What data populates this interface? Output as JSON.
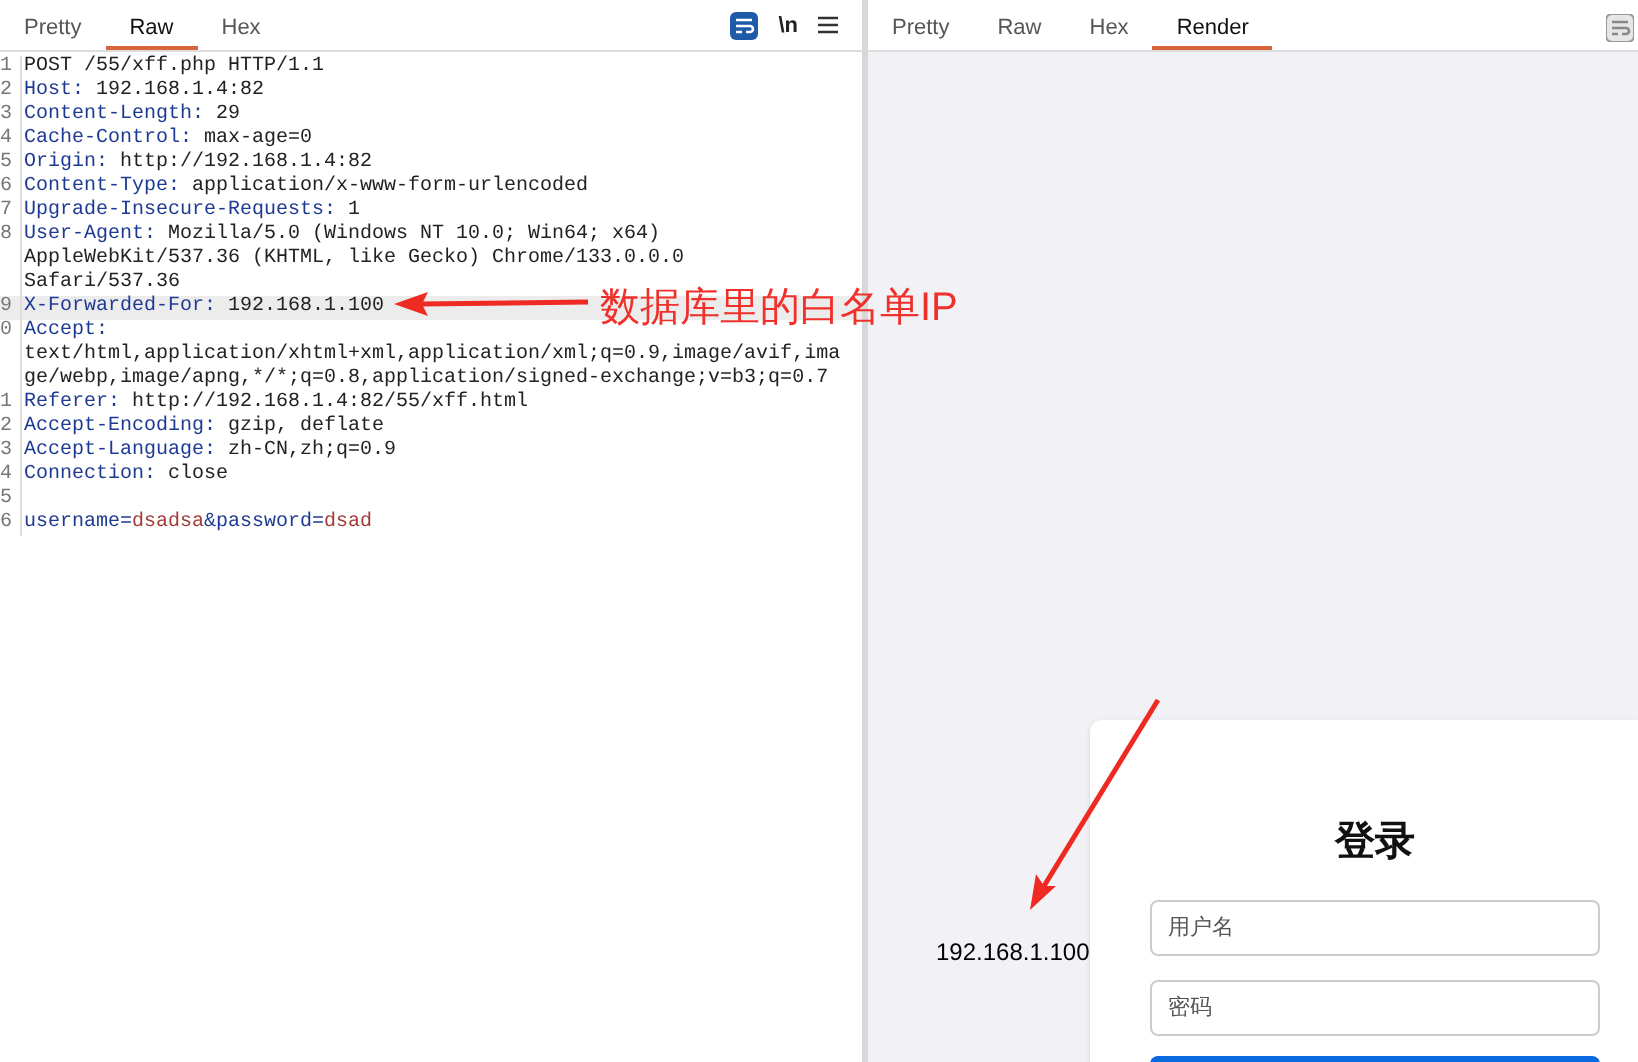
{
  "request_panel": {
    "tabs": [
      {
        "label": "Pretty",
        "selected": false
      },
      {
        "label": "Raw",
        "selected": true
      },
      {
        "label": "Hex",
        "selected": false
      }
    ],
    "newline_toggle": "\\n",
    "lines": [
      {
        "number": "1",
        "highlighted": false,
        "parts": [
          {
            "kind": "plain",
            "text": "POST /55/xff.php HTTP/1.1"
          }
        ]
      },
      {
        "number": "2",
        "highlighted": false,
        "parts": [
          {
            "kind": "name",
            "text": "Host:"
          },
          {
            "kind": "plain",
            "text": " 192.168.1.4:82"
          }
        ]
      },
      {
        "number": "3",
        "highlighted": false,
        "parts": [
          {
            "kind": "name",
            "text": "Content-Length:"
          },
          {
            "kind": "plain",
            "text": " 29"
          }
        ]
      },
      {
        "number": "4",
        "highlighted": false,
        "parts": [
          {
            "kind": "name",
            "text": "Cache-Control:"
          },
          {
            "kind": "plain",
            "text": " max-age=0"
          }
        ]
      },
      {
        "number": "5",
        "highlighted": false,
        "parts": [
          {
            "kind": "name",
            "text": "Origin:"
          },
          {
            "kind": "plain",
            "text": " http://192.168.1.4:82"
          }
        ]
      },
      {
        "number": "6",
        "highlighted": false,
        "parts": [
          {
            "kind": "name",
            "text": "Content-Type:"
          },
          {
            "kind": "plain",
            "text": " application/x-www-form-urlencoded"
          }
        ]
      },
      {
        "number": "7",
        "highlighted": false,
        "parts": [
          {
            "kind": "name",
            "text": "Upgrade-Insecure-Requests:"
          },
          {
            "kind": "plain",
            "text": " 1"
          }
        ]
      },
      {
        "number": "8",
        "highlighted": false,
        "parts": [
          {
            "kind": "name",
            "text": "User-Agent:"
          },
          {
            "kind": "plain",
            "text": " Mozilla/5.0 (Windows NT 10.0; Win64; x64)"
          }
        ]
      },
      {
        "highlighted": false,
        "parts": [
          {
            "kind": "plain",
            "text": "AppleWebKit/537.36 (KHTML, like Gecko) Chrome/133.0.0.0"
          }
        ]
      },
      {
        "highlighted": false,
        "parts": [
          {
            "kind": "plain",
            "text": "Safari/537.36"
          }
        ]
      },
      {
        "number": "9",
        "highlighted": true,
        "parts": [
          {
            "kind": "name",
            "text": "X-Forwarded-For:"
          },
          {
            "kind": "plain",
            "text": " 192.168.1.100"
          }
        ]
      },
      {
        "number": "0",
        "highlighted": false,
        "parts": [
          {
            "kind": "name",
            "text": "Accept:"
          }
        ]
      },
      {
        "highlighted": false,
        "parts": [
          {
            "kind": "plain",
            "text": "text/html,application/xhtml+xml,application/xml;q=0.9,image/avif,ima"
          }
        ]
      },
      {
        "highlighted": false,
        "parts": [
          {
            "kind": "plain",
            "text": "ge/webp,image/apng,*/*;q=0.8,application/signed-exchange;v=b3;q=0.7"
          }
        ]
      },
      {
        "number": "1",
        "highlighted": false,
        "parts": [
          {
            "kind": "name",
            "text": "Referer:"
          },
          {
            "kind": "plain",
            "text": " http://192.168.1.4:82/55/xff.html"
          }
        ]
      },
      {
        "number": "2",
        "highlighted": false,
        "parts": [
          {
            "kind": "name",
            "text": "Accept-Encoding:"
          },
          {
            "kind": "plain",
            "text": " gzip, deflate"
          }
        ]
      },
      {
        "number": "3",
        "highlighted": false,
        "parts": [
          {
            "kind": "name",
            "text": "Accept-Language:"
          },
          {
            "kind": "plain",
            "text": " zh-CN,zh;q=0.9"
          }
        ]
      },
      {
        "number": "4",
        "highlighted": false,
        "parts": [
          {
            "kind": "name",
            "text": "Connection:"
          },
          {
            "kind": "plain",
            "text": " close"
          }
        ]
      },
      {
        "number": "5",
        "highlighted": false
      },
      {
        "number": "6",
        "highlighted": false,
        "parts": [
          {
            "kind": "name",
            "text": "username="
          },
          {
            "kind": "param",
            "text": "dsadsa"
          },
          {
            "kind": "name",
            "text": "&password="
          },
          {
            "kind": "param",
            "text": "dsad"
          }
        ]
      }
    ]
  },
  "annotation": {
    "text": "数据库里的白名单IP"
  },
  "response_panel": {
    "tabs": [
      {
        "label": "Pretty",
        "selected": false
      },
      {
        "label": "Raw",
        "selected": false
      },
      {
        "label": "Hex",
        "selected": false
      },
      {
        "label": "Render",
        "selected": true
      }
    ],
    "render": {
      "client_ip": "192.168.1.100",
      "login": {
        "title": "登录",
        "username_placeholder": "用户名",
        "password_placeholder": "密码"
      }
    }
  }
}
